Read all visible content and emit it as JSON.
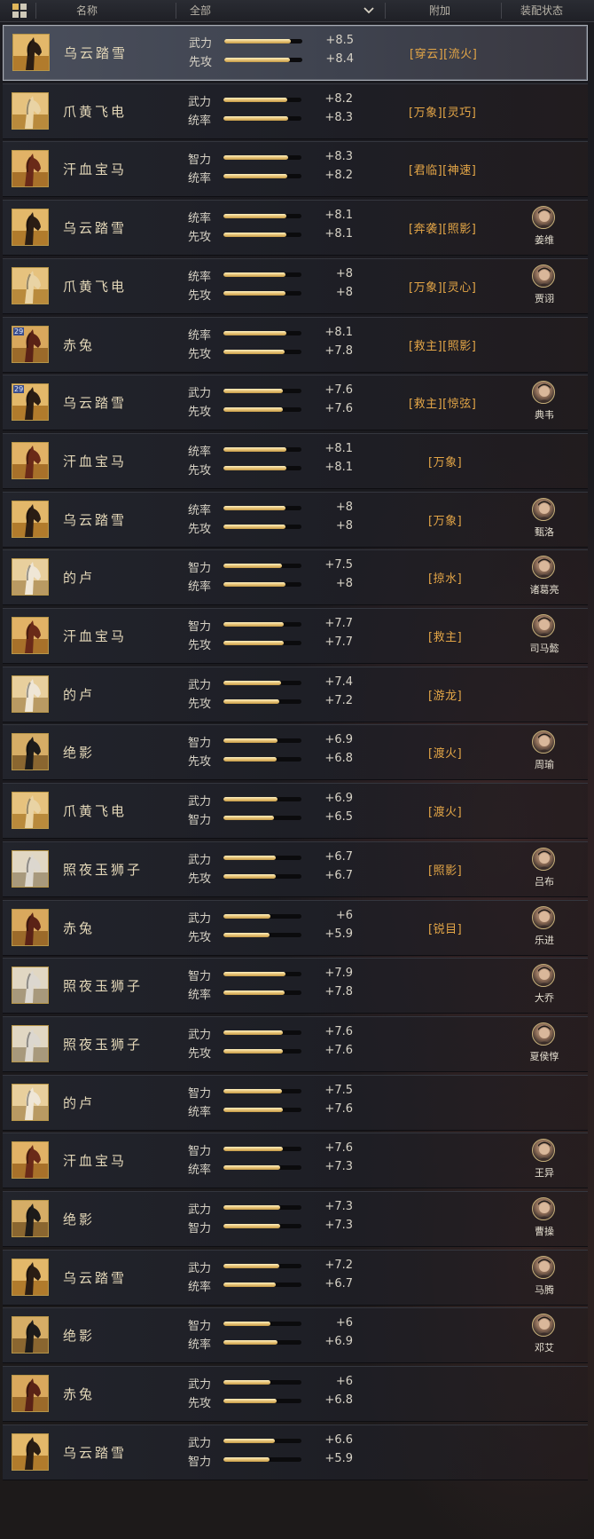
{
  "header": {
    "col_name": "名称",
    "filter_value": "全部",
    "col_extra": "附加",
    "col_equip": "装配状态",
    "icons": {
      "view": "grid-view-icon",
      "dropdown": "chevron-down-icon"
    }
  },
  "colors": {
    "accent_gold": "#e4a647",
    "bar_fill": "#e8c57a",
    "selected_border": "#a9adb6"
  },
  "horses": [
    {
      "name": "乌云踏雪",
      "portrait": "black-horse-icon",
      "selected": true,
      "stats": [
        {
          "label": "武力",
          "value": "+8.5",
          "level": 0.85
        },
        {
          "label": "先攻",
          "value": "+8.4",
          "level": 0.84
        }
      ],
      "extra": "[穿云][流火]",
      "equipped_by": ""
    },
    {
      "name": "爪黄飞电",
      "portrait": "white-horse-icon",
      "stats": [
        {
          "label": "武力",
          "value": "+8.2",
          "level": 0.82
        },
        {
          "label": "统率",
          "value": "+8.3",
          "level": 0.83
        }
      ],
      "extra": "[万象][灵巧]",
      "equipped_by": ""
    },
    {
      "name": "汗血宝马",
      "portrait": "red-horse-icon",
      "stats": [
        {
          "label": "智力",
          "value": "+8.3",
          "level": 0.83
        },
        {
          "label": "统率",
          "value": "+8.2",
          "level": 0.82
        }
      ],
      "extra": "[君临][神速]",
      "equipped_by": ""
    },
    {
      "name": "乌云踏雪",
      "portrait": "black-horse-icon",
      "stats": [
        {
          "label": "统率",
          "value": "+8.1",
          "level": 0.81
        },
        {
          "label": "先攻",
          "value": "+8.1",
          "level": 0.81
        }
      ],
      "extra": "[奔袭][照影]",
      "equipped_by": "姜维"
    },
    {
      "name": "爪黄飞电",
      "portrait": "white-horse-icon",
      "stats": [
        {
          "label": "统率",
          "value": "+8",
          "level": 0.8
        },
        {
          "label": "先攻",
          "value": "+8",
          "level": 0.8
        }
      ],
      "extra": "[万象][灵心]",
      "equipped_by": "贾诩"
    },
    {
      "name": "赤兔",
      "portrait": "red-hare-horse-icon",
      "badge": "29",
      "stats": [
        {
          "label": "统率",
          "value": "+8.1",
          "level": 0.81
        },
        {
          "label": "先攻",
          "value": "+7.8",
          "level": 0.78
        }
      ],
      "extra": "[救主][照影]",
      "equipped_by": ""
    },
    {
      "name": "乌云踏雪",
      "portrait": "black-horse-icon",
      "badge": "29",
      "stats": [
        {
          "label": "武力",
          "value": "+7.6",
          "level": 0.76
        },
        {
          "label": "先攻",
          "value": "+7.6",
          "level": 0.76
        }
      ],
      "extra": "[救主][惊弦]",
      "equipped_by": "典韦"
    },
    {
      "name": "汗血宝马",
      "portrait": "red-horse-icon",
      "stats": [
        {
          "label": "统率",
          "value": "+8.1",
          "level": 0.81
        },
        {
          "label": "先攻",
          "value": "+8.1",
          "level": 0.81
        }
      ],
      "extra": "[万象]",
      "equipped_by": ""
    },
    {
      "name": "乌云踏雪",
      "portrait": "black-horse-icon",
      "stats": [
        {
          "label": "统率",
          "value": "+8",
          "level": 0.8
        },
        {
          "label": "先攻",
          "value": "+8",
          "level": 0.8
        }
      ],
      "extra": "[万象]",
      "equipped_by": "甄洛"
    },
    {
      "name": "的卢",
      "portrait": "pale-horse-icon",
      "stats": [
        {
          "label": "智力",
          "value": "+7.5",
          "level": 0.75
        },
        {
          "label": "统率",
          "value": "+8",
          "level": 0.8
        }
      ],
      "extra": "[掠水]",
      "equipped_by": "诸葛亮"
    },
    {
      "name": "汗血宝马",
      "portrait": "red-horse-icon",
      "stats": [
        {
          "label": "智力",
          "value": "+7.7",
          "level": 0.77
        },
        {
          "label": "先攻",
          "value": "+7.7",
          "level": 0.77
        }
      ],
      "extra": "[救主]",
      "equipped_by": "司马懿"
    },
    {
      "name": "的卢",
      "portrait": "pale-horse-icon",
      "stats": [
        {
          "label": "武力",
          "value": "+7.4",
          "level": 0.74
        },
        {
          "label": "先攻",
          "value": "+7.2",
          "level": 0.72
        }
      ],
      "extra": "[游龙]",
      "equipped_by": ""
    },
    {
      "name": "绝影",
      "portrait": "dark-horse-icon",
      "stats": [
        {
          "label": "智力",
          "value": "+6.9",
          "level": 0.69
        },
        {
          "label": "先攻",
          "value": "+6.8",
          "level": 0.68
        }
      ],
      "extra": "[渡火]",
      "equipped_by": "周瑜"
    },
    {
      "name": "爪黄飞电",
      "portrait": "white-horse-icon",
      "stats": [
        {
          "label": "武力",
          "value": "+6.9",
          "level": 0.69
        },
        {
          "label": "智力",
          "value": "+6.5",
          "level": 0.65
        }
      ],
      "extra": "[渡火]",
      "equipped_by": ""
    },
    {
      "name": "照夜玉狮子",
      "portrait": "silver-horse-icon",
      "stats": [
        {
          "label": "武力",
          "value": "+6.7",
          "level": 0.67
        },
        {
          "label": "先攻",
          "value": "+6.7",
          "level": 0.67
        }
      ],
      "extra": "[照影]",
      "equipped_by": "吕布"
    },
    {
      "name": "赤兔",
      "portrait": "red-hare-horse-icon",
      "stats": [
        {
          "label": "武力",
          "value": "+6",
          "level": 0.6
        },
        {
          "label": "先攻",
          "value": "+5.9",
          "level": 0.59
        }
      ],
      "extra": "[锐目]",
      "equipped_by": "乐进"
    },
    {
      "name": "照夜玉狮子",
      "portrait": "silver-horse-icon",
      "stats": [
        {
          "label": "智力",
          "value": "+7.9",
          "level": 0.79
        },
        {
          "label": "统率",
          "value": "+7.8",
          "level": 0.78
        }
      ],
      "extra": "",
      "equipped_by": "大乔"
    },
    {
      "name": "照夜玉狮子",
      "portrait": "silver-horse-icon",
      "stats": [
        {
          "label": "武力",
          "value": "+7.6",
          "level": 0.76
        },
        {
          "label": "先攻",
          "value": "+7.6",
          "level": 0.76
        }
      ],
      "extra": "",
      "equipped_by": "夏侯惇"
    },
    {
      "name": "的卢",
      "portrait": "pale-horse-icon",
      "stats": [
        {
          "label": "智力",
          "value": "+7.5",
          "level": 0.75
        },
        {
          "label": "统率",
          "value": "+7.6",
          "level": 0.76
        }
      ],
      "extra": "",
      "equipped_by": ""
    },
    {
      "name": "汗血宝马",
      "portrait": "red-horse-icon",
      "stats": [
        {
          "label": "智力",
          "value": "+7.6",
          "level": 0.76
        },
        {
          "label": "统率",
          "value": "+7.3",
          "level": 0.73
        }
      ],
      "extra": "",
      "equipped_by": "王异"
    },
    {
      "name": "绝影",
      "portrait": "dark-horse-icon",
      "stats": [
        {
          "label": "武力",
          "value": "+7.3",
          "level": 0.73
        },
        {
          "label": "智力",
          "value": "+7.3",
          "level": 0.73
        }
      ],
      "extra": "",
      "equipped_by": "曹操"
    },
    {
      "name": "乌云踏雪",
      "portrait": "black-horse-icon",
      "stats": [
        {
          "label": "武力",
          "value": "+7.2",
          "level": 0.72
        },
        {
          "label": "统率",
          "value": "+6.7",
          "level": 0.67
        }
      ],
      "extra": "",
      "equipped_by": "马腾"
    },
    {
      "name": "绝影",
      "portrait": "dark-horse-icon",
      "stats": [
        {
          "label": "智力",
          "value": "+6",
          "level": 0.6
        },
        {
          "label": "统率",
          "value": "+6.9",
          "level": 0.69
        }
      ],
      "extra": "",
      "equipped_by": "邓艾"
    },
    {
      "name": "赤兔",
      "portrait": "red-hare-horse-icon",
      "stats": [
        {
          "label": "武力",
          "value": "+6",
          "level": 0.6
        },
        {
          "label": "先攻",
          "value": "+6.8",
          "level": 0.68
        }
      ],
      "extra": "",
      "equipped_by": ""
    },
    {
      "name": "乌云踏雪",
      "portrait": "black-horse-icon",
      "stats": [
        {
          "label": "武力",
          "value": "+6.6",
          "level": 0.66
        },
        {
          "label": "智力",
          "value": "+5.9",
          "level": 0.59
        }
      ],
      "extra": "",
      "equipped_by": ""
    }
  ]
}
